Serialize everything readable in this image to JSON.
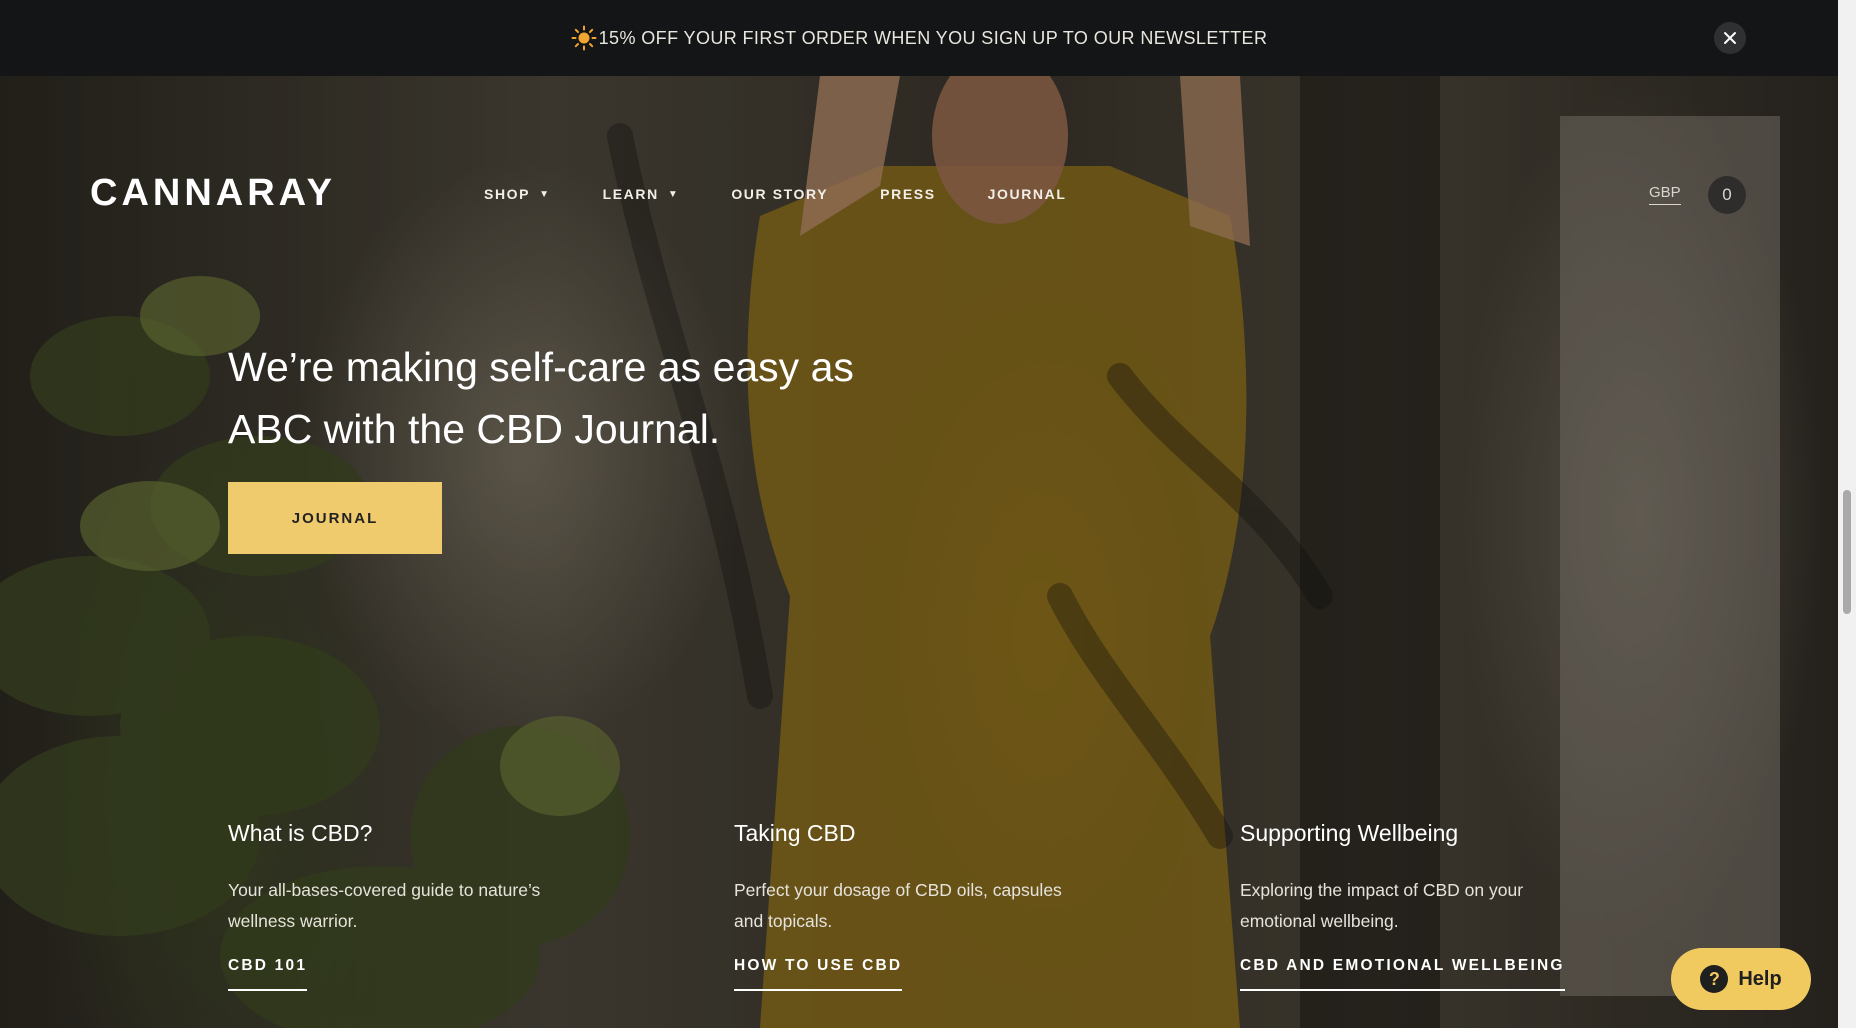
{
  "announcement": {
    "text": "15% OFF YOUR FIRST ORDER WHEN YOU SIGN UP TO OUR NEWSLETTER",
    "icon": "sun-icon",
    "close_icon": "close-icon"
  },
  "header": {
    "logo": "CANNARAY",
    "nav": [
      {
        "label": "SHOP",
        "has_dropdown": true
      },
      {
        "label": "LEARN",
        "has_dropdown": true
      },
      {
        "label": "OUR STORY",
        "has_dropdown": false
      },
      {
        "label": "PRESS",
        "has_dropdown": false
      },
      {
        "label": "JOURNAL",
        "has_dropdown": false
      }
    ],
    "dropdown_glyph": "▼",
    "currency": "GBP",
    "cart_count": "0"
  },
  "hero": {
    "headline": "We’re making self-care as easy as ABC with the CBD Journal.",
    "button_label": "JOURNAL"
  },
  "cards": [
    {
      "title": "What is CBD?",
      "body": "Your all-bases-covered guide to nature’s wellness warrior.",
      "link": "CBD 101"
    },
    {
      "title": "Taking CBD",
      "body": "Perfect your dosage of CBD oils, capsules and topicals.",
      "link": "HOW TO USE CBD"
    },
    {
      "title": "Supporting Wellbeing",
      "body": "Exploring the impact of CBD on your emotional wellbeing.",
      "link": "CBD AND EMOTIONAL WELLBEING"
    }
  ],
  "help": {
    "label": "Help",
    "icon_glyph": "?"
  },
  "colors": {
    "announcement_bg": "#131516",
    "accent_button": "#efcb6e",
    "help_button": "#f0c95f"
  }
}
